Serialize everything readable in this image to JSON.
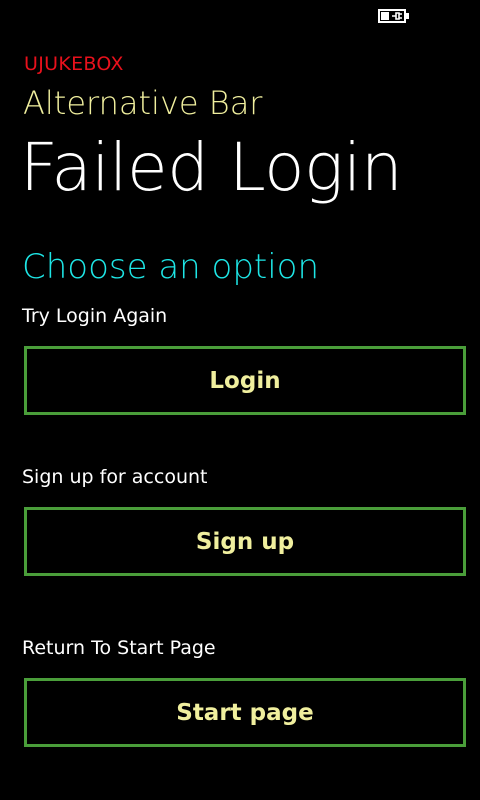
{
  "colors": {
    "background": "#000000",
    "app_title": "#e8111c",
    "subtitle": "#f0ef9e",
    "title": "#ffffff",
    "section_heading": "#1ee6e6",
    "label": "#ffffff",
    "button_border": "#4a9e3a",
    "button_text": "#f0ef9e"
  },
  "status_bar": {
    "battery_icon": "battery-charging-icon"
  },
  "header": {
    "app_title": "UJUKEBOX",
    "subtitle": "Alternative Bar",
    "title": "Failed Login"
  },
  "main": {
    "heading": "Choose an option",
    "options": [
      {
        "label": "Try Login Again",
        "button": "Login"
      },
      {
        "label": "Sign up for account",
        "button": "Sign up"
      },
      {
        "label": "Return To Start Page",
        "button": "Start page"
      }
    ]
  }
}
